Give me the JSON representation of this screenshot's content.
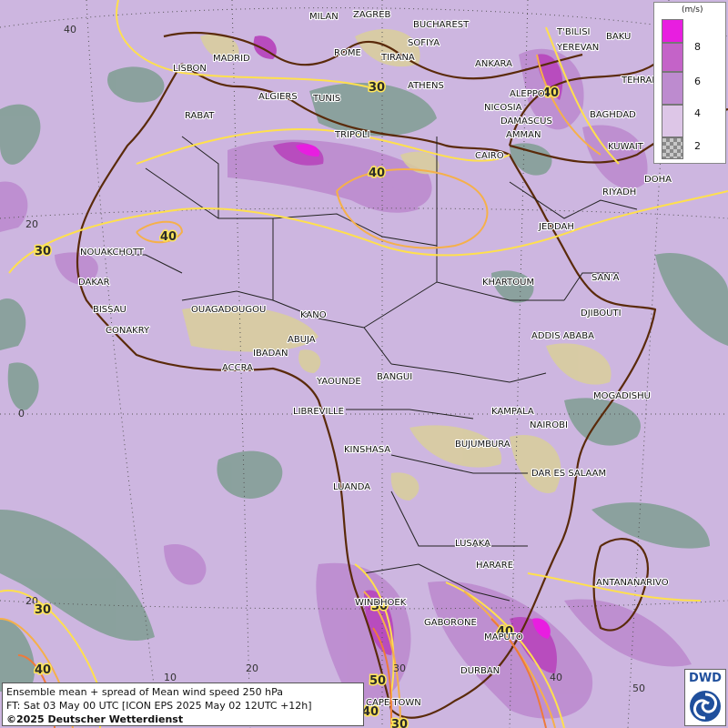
{
  "map": {
    "cities": [
      "MILAN",
      "ZAGREB",
      "BUCHAREST",
      "T'BILISI",
      "BAKU",
      "MADRID",
      "ROME",
      "SOFIYA",
      "YEREVAN",
      "TEHRAN",
      "LISBON",
      "TIRANA",
      "ANKARA",
      "ALGIERS",
      "TUNIS",
      "ATHENS",
      "ALEPPO",
      "RABAT",
      "NICOSIA",
      "BAGHDAD",
      "DAMASCUS",
      "AMMAN",
      "TRIPOLI",
      "KUWAIT",
      "CAIRO",
      "DOHA",
      "RIYADH",
      "JEDDAH",
      "NOUAKCHOTT",
      "SAN'A",
      "DAKAR",
      "KHARTOUM",
      "BISSAU",
      "OUAGADOUGOU",
      "DJIBOUTI",
      "KANO",
      "CONAKRY",
      "ABUJA",
      "ADDIS ABABA",
      "IBADAN",
      "ACCRA",
      "YAOUNDE",
      "BANGUI",
      "MOGADISHU",
      "LIBREVILLE",
      "KAMPALA",
      "NAIROBI",
      "KINSHASA",
      "BUJUMBURA",
      "DAR ES SALAAM",
      "LUANDA",
      "LUSAKA",
      "HARARE",
      "ANTANANARIVO",
      "WINDHOEK",
      "GABORONE",
      "MAPUTO",
      "DURBAN",
      "CAPE TOWN"
    ],
    "isoline_labels": [
      "30",
      "40",
      "40",
      "30",
      "40",
      "30",
      "40",
      "30",
      "50",
      "40",
      "40",
      "30"
    ],
    "grid_labels": [
      "40",
      "20",
      "0",
      "20",
      "40",
      "10",
      "20",
      "30",
      "40",
      "50"
    ]
  },
  "legend": {
    "unit": "(m/s)",
    "ticks": [
      "8",
      "6",
      "4",
      "2"
    ],
    "colors": [
      "#e81ee0",
      "#c463c8",
      "#bd8bcf",
      "#ddc6e7",
      "checker"
    ]
  },
  "info": {
    "line1": "Ensemble mean + spread of Mean wind speed 250 hPa",
    "line2": "FT: Sat 03 May 00 UTC [ICON EPS 2025 May 02 12UTC +12h]",
    "line3": "©2025 Deutscher Wetterdienst"
  },
  "logo": {
    "text": "DWD"
  },
  "colors": {
    "background": "#cdb6e0",
    "coast": "#5a2a0a",
    "border": "#222222",
    "grid": "#555555"
  }
}
